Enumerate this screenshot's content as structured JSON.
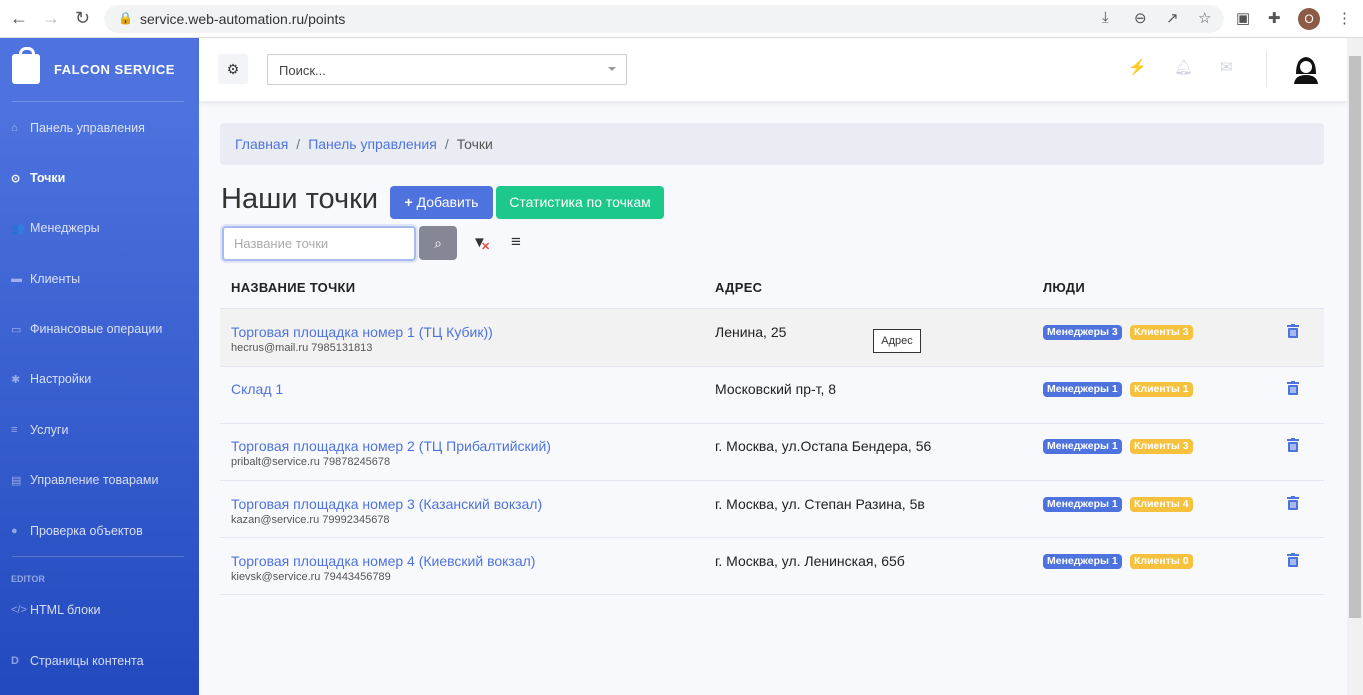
{
  "browser": {
    "url": "service.web-automation.ru/points",
    "profile_initial": "O"
  },
  "sidebar": {
    "brand": "FALCON SERVICE",
    "items": [
      {
        "label": "Панель управления",
        "icon": "home-icon",
        "glyph": "⌂"
      },
      {
        "label": "Точки",
        "icon": "dot-circle-icon",
        "glyph": "⊙",
        "active": true
      },
      {
        "label": "Менеджеры",
        "icon": "users-icon",
        "glyph": "👥"
      },
      {
        "label": "Клиенты",
        "icon": "handshake-icon",
        "glyph": "▬"
      },
      {
        "label": "Финансовые операции",
        "icon": "money-icon",
        "glyph": "▭"
      },
      {
        "label": "Настройки",
        "icon": "gear-icon",
        "glyph": "✱"
      },
      {
        "label": "Услуги",
        "icon": "bars-icon",
        "glyph": "≡"
      },
      {
        "label": "Управление товарами",
        "icon": "list-icon",
        "glyph": "▤"
      },
      {
        "label": "Проверка объектов",
        "icon": "check-circle-icon",
        "glyph": "●"
      }
    ],
    "editor_heading": "EDITOR",
    "editor_items": [
      {
        "label": "HTML блоки",
        "glyph": "</>"
      },
      {
        "label": "Страницы контента",
        "glyph": "D"
      }
    ]
  },
  "topbar": {
    "search_placeholder": "Поиск..."
  },
  "breadcrumb": {
    "home": "Главная",
    "dashboard": "Панель управления",
    "current": "Точки",
    "sep": "/"
  },
  "page": {
    "title": "Наши точки",
    "add_label": "Добавить",
    "stats_label": "Статистика по точкам",
    "name_placeholder": "Название точки"
  },
  "table": {
    "headers": [
      "НАЗВАНИЕ ТОЧКИ",
      "АДРЕС",
      "ЛЮДИ"
    ],
    "rows": [
      {
        "name": "Торговая площадка номер 1 (ТЦ Кубик))",
        "contact": "hecrus@mail.ru  7985131813",
        "address": "Ленина, 25",
        "managers": "Менеджеры 3",
        "clients": "Клиенты 3"
      },
      {
        "name": "Склад 1",
        "contact": "",
        "address": "Московский пр-т, 8",
        "managers": "Менеджеры 1",
        "clients": "Клиенты 1"
      },
      {
        "name": "Торговая площадка номер 2 (ТЦ Прибалтийский)",
        "contact": "pribalt@service.ru  79878245678",
        "address": "г. Москва, ул.Остапа Бендера, 56",
        "managers": "Менеджеры 1",
        "clients": "Клиенты 3"
      },
      {
        "name": "Торговая площадка номер 3 (Казанский вокзал)",
        "contact": "kazan@service.ru  79992345678",
        "address": "г. Москва, ул. Степан Разина, 5в",
        "managers": "Менеджеры 1",
        "clients": "Клиенты 4"
      },
      {
        "name": "Торговая площадка номер 4 (Киевский вокзал)",
        "contact": "kievsk@service.ru  79443456789",
        "address": "г. Москва, ул. Ленинская, 65б",
        "managers": "Менеджеры 1",
        "clients": "Клиенты 0"
      }
    ]
  },
  "tooltip": "Адрес",
  "colors": {
    "primary": "#4e73df",
    "success": "#1cc88a",
    "warning": "#f6c23e"
  }
}
